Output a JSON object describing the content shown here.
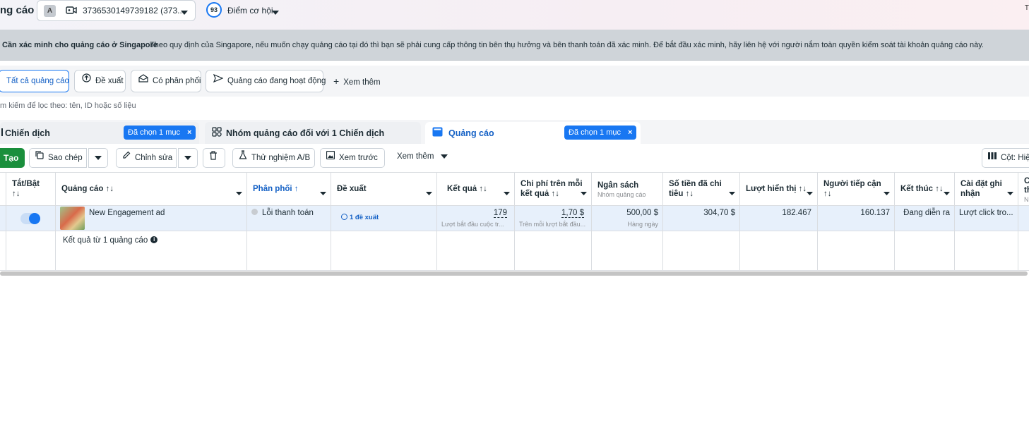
{
  "header": {
    "title": "ng cáo",
    "account_badge": "A",
    "account_id": "3736530149739182 (373...",
    "score": "93",
    "score_label": "Điểm cơ hội",
    "corner": "T"
  },
  "banner": {
    "title": "Cần xác minh cho quảng cáo ở Singapore",
    "text": "Theo quy định của Singapore, nếu muốn chạy quảng cáo tại đó thì bạn sẽ phải cung cấp thông tin bên thụ hưởng và bên thanh toán đã xác minh. Để bắt đầu xác minh, hãy liên hệ với người nắm toàn quyền kiểm soát tài khoản quảng cáo này."
  },
  "filters": {
    "all": "Tất cả quảng cáo",
    "suggest": "Đề xuất",
    "delivering": "Có phân phối",
    "active": "Quảng cáo đang hoạt động",
    "more": "Xem thêm"
  },
  "search": {
    "placeholder": "m kiếm để lọc theo: tên, ID hoặc số liệu"
  },
  "levels": {
    "campaign": "Chiến dịch",
    "campaign_chip": "Đã chọn 1 mục",
    "adset": "Nhóm quảng cáo đối với 1 Chiến dịch",
    "ad": "Quảng cáo",
    "ad_chip": "Đã chọn 1 mục"
  },
  "toolbar": {
    "create": "Tạo",
    "copy": "Sao chép",
    "edit": "Chỉnh sửa",
    "ab_test": "Thử nghiệm A/B",
    "preview": "Xem trước",
    "more": "Xem thêm",
    "columns": "Cột: Hiệ"
  },
  "table": {
    "headers": {
      "toggle": "Tắt/Bật",
      "toggle_sort": "↑↓",
      "ad": "Quảng cáo ↑↓",
      "delivery": "Phân phối ↑",
      "suggestion": "Đề xuất",
      "results": "Kết quả ↑↓",
      "cpr_line1": "Chi phí trên mỗi",
      "cpr_line2": "kết quả ↑↓",
      "budget": "Ngân sách",
      "budget_sub": "Nhóm quảng cáo",
      "spent_line1": "Số tiền đã chi",
      "spent_line2": "tiêu ↑↓",
      "impressions": "Lượt hiển thị ↑↓",
      "reach_line1": "Người tiếp cận",
      "reach_line2": "↑↓",
      "ends": "Kết thúc ↑↓",
      "attr_line1": "Cài đặt ghi",
      "attr_line2": "nhận",
      "extra_line1": "C",
      "extra_line2": "th",
      "extra_line3": "N"
    },
    "row": {
      "ad_name": "New Engagement ad",
      "delivery": "Lỗi thanh toán",
      "suggestion": "1 đề xuất",
      "results": "179",
      "results_sub": "Lượt bắt đầu cuộc tr...",
      "cpr": "1,70 $",
      "cpr_sub": "Trên mỗi lượt bắt đầu...",
      "budget": "500,00 $",
      "budget_sub": "Hàng ngày",
      "spent": "304,70 $",
      "impressions": "182.467",
      "reach": "160.137",
      "ends": "Đang diễn ra",
      "attribution": "Lượt click tro..."
    },
    "summary": "Kết quả từ 1 quảng cáo"
  },
  "colors": {
    "accent": "#1877f2",
    "create": "#1a8f3c",
    "selected_row": "#e7f0fb"
  }
}
